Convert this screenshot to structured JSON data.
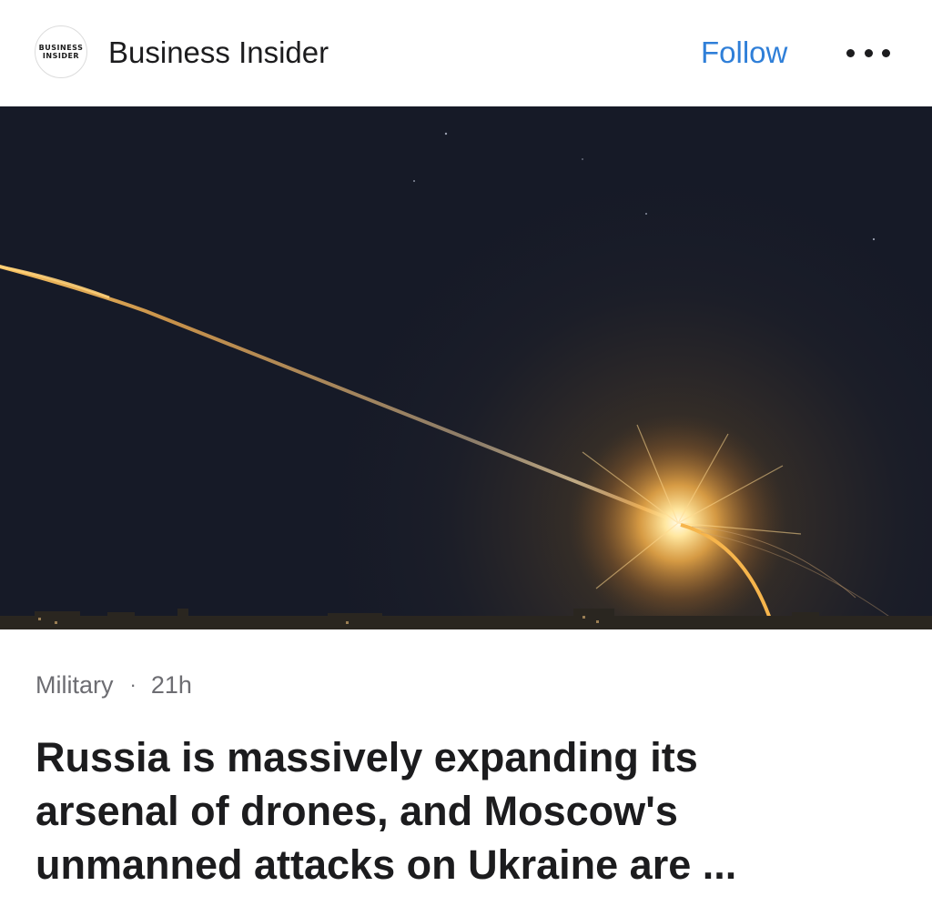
{
  "header": {
    "logo_line1": "BUSINESS",
    "logo_line2": "INSIDER",
    "publisher": "Business Insider",
    "follow_label": "Follow",
    "more_icon": "more-horizontal-icon"
  },
  "article": {
    "category": "Military",
    "separator": "·",
    "age": "21h",
    "headline_lines": [
      "Russia is massively expanding its",
      "arsenal of drones, and Moscow's",
      "unmanned attacks on Ukraine are ..."
    ]
  },
  "colors": {
    "accent": "#2f7fd8",
    "text": "#1c1c1e",
    "meta": "#6d6d72",
    "sky": "#161a27"
  }
}
